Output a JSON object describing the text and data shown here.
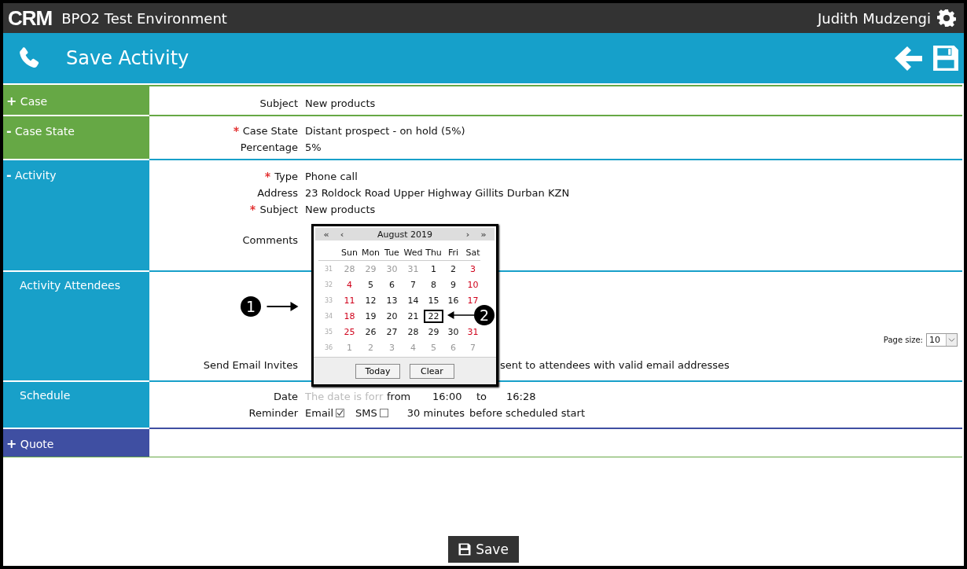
{
  "top_bar": {
    "logo": "CRM",
    "title": "BPO2 Test Environment",
    "user": "Judith Mudzengi"
  },
  "header": {
    "title": "Save Activity"
  },
  "sections": [
    {
      "toggle": "+",
      "title": "Case",
      "color": "#66a845",
      "fields": [
        {
          "kind": "text",
          "label": "Subject",
          "required": false,
          "value": "New products"
        }
      ]
    },
    {
      "toggle": "-",
      "title": "Case State",
      "color": "#66a845",
      "fields": [
        {
          "kind": "text",
          "label": "Case State",
          "required": true,
          "value": "Distant prospect - on hold (5%)"
        },
        {
          "kind": "text",
          "label": "Percentage",
          "required": false,
          "value": "5%"
        }
      ]
    },
    {
      "toggle": "-",
      "title": "Activity",
      "color": "#18a0c9",
      "fields": [
        {
          "kind": "text",
          "label": "Type",
          "required": true,
          "value": "Phone call"
        },
        {
          "kind": "text",
          "label": "Address",
          "required": false,
          "value": "23 Roldock Road Upper Highway Gillits Durban KZN"
        },
        {
          "kind": "text",
          "label": "Subject",
          "required": true,
          "value": "New products"
        },
        {
          "kind": "textarea",
          "label": "Comments",
          "required": false
        }
      ]
    },
    {
      "title": "Activity Attendees",
      "color": "#18a0c9",
      "fields": [
        {
          "kind": "pagesize",
          "label": "Page size:",
          "value": "10"
        },
        {
          "kind": "covered",
          "label": "Send Email Invites",
          "required": false,
          "value": "sent to attendees with valid email addresses"
        }
      ]
    },
    {
      "title": "Schedule",
      "color": "#18a0c9",
      "fields": [
        {
          "kind": "date",
          "label": "Date",
          "required": false,
          "placeholder": "The date is forr",
          "from": "from",
          "start": "16:00",
          "to": "to",
          "end": "16:28"
        },
        {
          "kind": "reminder",
          "label": "Reminder",
          "required": false,
          "email": "Email",
          "email_checked": true,
          "sms": "SMS",
          "sms_checked": false,
          "minutes": "30 minutes",
          "after": "before scheduled start"
        }
      ]
    },
    {
      "toggle": "+",
      "title": "Quote",
      "color": "#3f4fa2"
    }
  ],
  "calendar": {
    "nav": [
      "«",
      "‹",
      "›",
      "»"
    ],
    "month": "August 2019",
    "weekdays": [
      "Sun",
      "Mon",
      "Tue",
      "Wed",
      "Thu",
      "Fri",
      "Sat"
    ],
    "weeks": [
      {
        "number": "31",
        "days": [
          {
            "text": "28",
            "kind": "other",
            "selected": false
          },
          {
            "text": "29",
            "kind": "other",
            "selected": false
          },
          {
            "text": "30",
            "kind": "other",
            "selected": false
          },
          {
            "text": "31",
            "kind": "other",
            "selected": false
          },
          {
            "text": "1",
            "kind": "weekday",
            "selected": false
          },
          {
            "text": "2",
            "kind": "weekday",
            "selected": false
          },
          {
            "text": "3",
            "kind": "weekend",
            "selected": false
          }
        ]
      },
      {
        "number": "32",
        "days": [
          {
            "text": "4",
            "kind": "weekend",
            "selected": false
          },
          {
            "text": "5",
            "kind": "weekday",
            "selected": false
          },
          {
            "text": "6",
            "kind": "weekday",
            "selected": false
          },
          {
            "text": "7",
            "kind": "weekday",
            "selected": false
          },
          {
            "text": "8",
            "kind": "weekday",
            "selected": false
          },
          {
            "text": "9",
            "kind": "weekday",
            "selected": false
          },
          {
            "text": "10",
            "kind": "weekend",
            "selected": false
          }
        ]
      },
      {
        "number": "33",
        "days": [
          {
            "text": "11",
            "kind": "weekend",
            "selected": false
          },
          {
            "text": "12",
            "kind": "weekday",
            "selected": false
          },
          {
            "text": "13",
            "kind": "weekday",
            "selected": false
          },
          {
            "text": "14",
            "kind": "weekday",
            "selected": false
          },
          {
            "text": "15",
            "kind": "weekday",
            "selected": false
          },
          {
            "text": "16",
            "kind": "weekday",
            "selected": false
          },
          {
            "text": "17",
            "kind": "weekend",
            "selected": false
          }
        ]
      },
      {
        "number": "34",
        "days": [
          {
            "text": "18",
            "kind": "weekend",
            "selected": false
          },
          {
            "text": "19",
            "kind": "weekday",
            "selected": false
          },
          {
            "text": "20",
            "kind": "weekday",
            "selected": false
          },
          {
            "text": "21",
            "kind": "weekday",
            "selected": false
          },
          {
            "text": "22",
            "kind": "weekday",
            "selected": true
          }
        ]
      },
      {
        "number": "35",
        "days": [
          {
            "text": "25",
            "kind": "weekend",
            "selected": false
          },
          {
            "text": "26",
            "kind": "weekday",
            "selected": false
          },
          {
            "text": "27",
            "kind": "weekday",
            "selected": false
          },
          {
            "text": "28",
            "kind": "weekday",
            "selected": false
          },
          {
            "text": "29",
            "kind": "weekday",
            "selected": false
          },
          {
            "text": "30",
            "kind": "weekday",
            "selected": false
          },
          {
            "text": "31",
            "kind": "weekend",
            "selected": false
          }
        ]
      },
      {
        "number": "36",
        "days": [
          {
            "text": "1",
            "kind": "other",
            "selected": false
          },
          {
            "text": "2",
            "kind": "other",
            "selected": false
          },
          {
            "text": "3",
            "kind": "other",
            "selected": false
          },
          {
            "text": "4",
            "kind": "other",
            "selected": false
          },
          {
            "text": "5",
            "kind": "other",
            "selected": false
          },
          {
            "text": "6",
            "kind": "other",
            "selected": false
          },
          {
            "text": "7",
            "kind": "other",
            "selected": false
          }
        ]
      }
    ],
    "buttons": [
      "Today",
      "Clear"
    ]
  },
  "callouts": [
    {
      "number": "1",
      "kind": "right"
    },
    {
      "number": "2",
      "kind": "left"
    }
  ],
  "save_button": "Save"
}
